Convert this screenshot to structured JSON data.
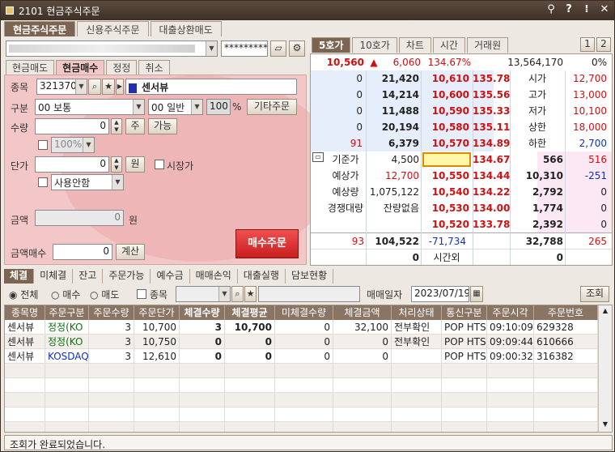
{
  "window": {
    "title": "2101 현금주식주문",
    "btn_pin": "⚲",
    "btn_help": "?",
    "btn_settings": "⁞",
    "btn_close": "✕"
  },
  "top_tabs": [
    {
      "label": "현금주식주문"
    },
    {
      "label": "신용주식주문"
    },
    {
      "label": "대출상환매도"
    }
  ],
  "account": {
    "password": "**********"
  },
  "order_tabs": [
    {
      "label": "현금매도"
    },
    {
      "label": "현금매수"
    },
    {
      "label": "정정"
    },
    {
      "label": "취소"
    }
  ],
  "form": {
    "stock_label": "종목",
    "stock_code": "321370",
    "stock_name": "센서뷰",
    "type_label": "구분",
    "type_value": "00 보통",
    "cond_value": "00 일반",
    "pct_value": "100",
    "pct_unit": "%",
    "other_order": "기타주문",
    "qty_label": "수량",
    "qty_value": "0",
    "qty_unit": "주",
    "possible_btn": "가능",
    "ratio_value": "100%",
    "price_label": "단가",
    "price_value": "0",
    "price_unit": "원",
    "market_price": "시장가",
    "use_select": "사용안함",
    "amount_label": "금액",
    "amount_value": "0",
    "amount_unit": "원",
    "amount_qty_label": "금액매수",
    "amount_qty_value": "0",
    "calc_btn": "계산",
    "order_btn": "매수주문"
  },
  "ob_tabs": [
    {
      "label": "5호가"
    },
    {
      "label": "10호가"
    },
    {
      "label": "차트"
    },
    {
      "label": "시간"
    },
    {
      "label": "거래원"
    }
  ],
  "ob_pages": [
    "1",
    "2"
  ],
  "quote": {
    "price": "10,560",
    "arrow": "▲",
    "change": "6,060",
    "rate": "134.67%",
    "volume": "13,564,170",
    "ratio": "0%"
  },
  "asks": [
    {
      "a": "0",
      "qty": "21,420",
      "price": "10,610",
      "rate": "135.78",
      "lbl": "시가",
      "val": "12,700"
    },
    {
      "a": "0",
      "qty": "14,214",
      "price": "10,600",
      "rate": "135.56",
      "lbl": "고가",
      "val": "13,000"
    },
    {
      "a": "0",
      "qty": "11,488",
      "price": "10,590",
      "rate": "135.33",
      "lbl": "저가",
      "val": "10,100"
    },
    {
      "a": "0",
      "qty": "20,194",
      "price": "10,580",
      "rate": "135.11",
      "lbl": "상한",
      "val": "18,000"
    },
    {
      "a": "91",
      "qty": "6,379",
      "price": "10,570",
      "rate": "134.89",
      "lbl": "하한",
      "val": "2,700"
    }
  ],
  "bids": [
    {
      "lbl": "기준가",
      "val": "4,500",
      "price": "10,560",
      "rate": "134.67",
      "qty": "566",
      "b": "516"
    },
    {
      "lbl": "예상가",
      "val": "12,700",
      "price": "10,550",
      "rate": "134.44",
      "qty": "10,310",
      "b": "-251"
    },
    {
      "lbl": "예상량",
      "val": "1,075,122",
      "price": "10,540",
      "rate": "134.22",
      "qty": "2,792",
      "b": "0"
    },
    {
      "lbl": "경쟁대량",
      "val": "잔량없음",
      "price": "10,530",
      "rate": "134.00",
      "qty": "1,774",
      "b": "0"
    },
    {
      "lbl": "",
      "val": "",
      "price": "10,520",
      "rate": "133.78",
      "qty": "2,392",
      "b": "0"
    }
  ],
  "ob_totals": {
    "a": "93",
    "ask_total": "104,522",
    "diff": "-71,734",
    "bid_total": "32,788",
    "b": "265"
  },
  "ob_after": {
    "ask": "0",
    "label": "시간외",
    "bid": "0"
  },
  "bottom_tabs": [
    {
      "label": "체결"
    },
    {
      "label": "미체결"
    },
    {
      "label": "잔고"
    },
    {
      "label": "주문가능"
    },
    {
      "label": "예수금"
    },
    {
      "label": "매매손익"
    },
    {
      "label": "대출실행"
    },
    {
      "label": "담보현황"
    }
  ],
  "filter": {
    "all": "전체",
    "buy": "매수",
    "sell": "매도",
    "stock": "종목",
    "date_label": "매매일자",
    "date": "2023/07/19",
    "query_btn": "조회"
  },
  "grid": {
    "headers": [
      "종목명",
      "주문구분",
      "주문수량",
      "주문단가",
      "체결수량",
      "체결평균",
      "미체결수량",
      "체결금액",
      "처리상태",
      "통신구분",
      "주문시각",
      "주문번호"
    ],
    "rows": [
      [
        "센서뷰",
        "정정(KO",
        "3",
        "10,700",
        "3",
        "10,700",
        "0",
        "32,100",
        "전부확인",
        "POP HTS",
        "09:10:09",
        "629328"
      ],
      [
        "센서뷰",
        "정정(KO",
        "3",
        "10,750",
        "0",
        "0",
        "0",
        "0",
        "전부확인",
        "POP HTS",
        "09:09:44",
        "610666"
      ],
      [
        "센서뷰",
        "KOSDAQ",
        "3",
        "12,610",
        "0",
        "0",
        "0",
        "0",
        "",
        "POP HTS",
        "09:00:32",
        "316382"
      ]
    ]
  },
  "status": "조회가 완료되었습니다.",
  "colors": {
    "accent": "#7b6552",
    "up": "#d01010",
    "down": "#1030c0"
  }
}
